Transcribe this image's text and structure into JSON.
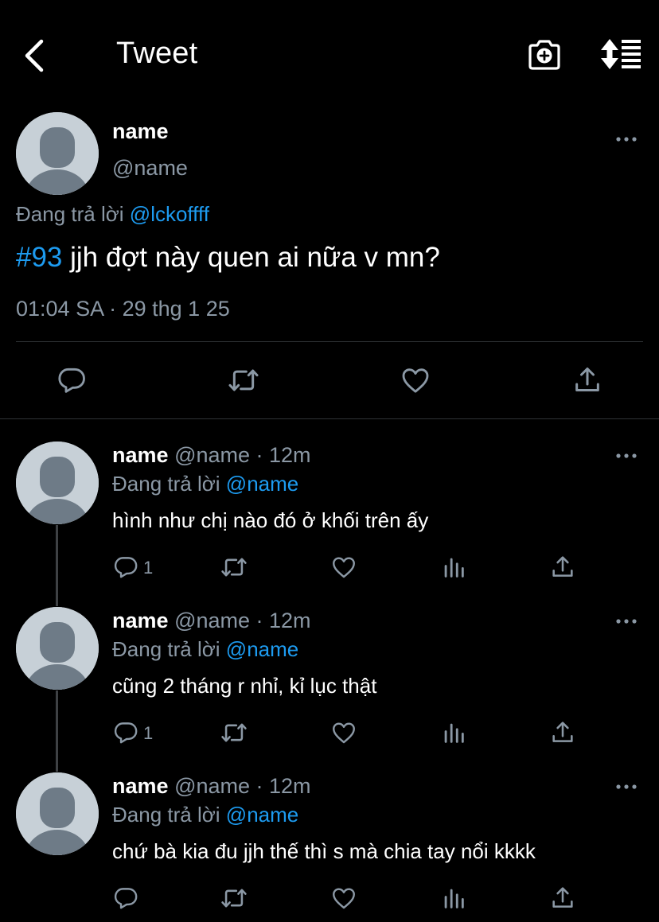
{
  "header": {
    "title": "Tweet",
    "back_icon": "chevron-left-icon",
    "camera_icon": "camera-add-icon",
    "sort_icon": "sort-list-icon"
  },
  "main_tweet": {
    "name": "name",
    "handle": "@name",
    "reply_prefix": "Đang trả lời",
    "reply_to": "@lckoffff",
    "hashtag": "#93",
    "text": " jjh đợt này quen ai nữa v mn?",
    "time": "01:04 SA",
    "separator": " · ",
    "date": "29 thg 1 25"
  },
  "replies": [
    {
      "name": "name",
      "handle": "@name",
      "time_sep": " · ",
      "time": "12m",
      "reply_prefix": "Đang trả lời",
      "reply_to": "@name",
      "text": "hình như chị nào đó ở khối trên ấy",
      "reply_count": "1"
    },
    {
      "name": "name",
      "handle": "@name",
      "time_sep": " · ",
      "time": "12m",
      "reply_prefix": "Đang trả lời",
      "reply_to": "@name",
      "text": "cũng 2 tháng r nhỉ, kỉ lục thật",
      "reply_count": "1"
    },
    {
      "name": "name",
      "handle": "@name",
      "time_sep": " · ",
      "time": "12m",
      "reply_prefix": "Đang trả lời",
      "reply_to": "@name",
      "text": "chứ bà kia đu jjh thế thì s mà chia tay nổi kkkk",
      "reply_count": ""
    }
  ],
  "colors": {
    "background": "#000000",
    "link": "#1d9bf0",
    "muted": "#8b98a5",
    "divider": "#2f3336",
    "avatar_bg": "#c7d0d7",
    "avatar_fg": "#6e7b87"
  }
}
